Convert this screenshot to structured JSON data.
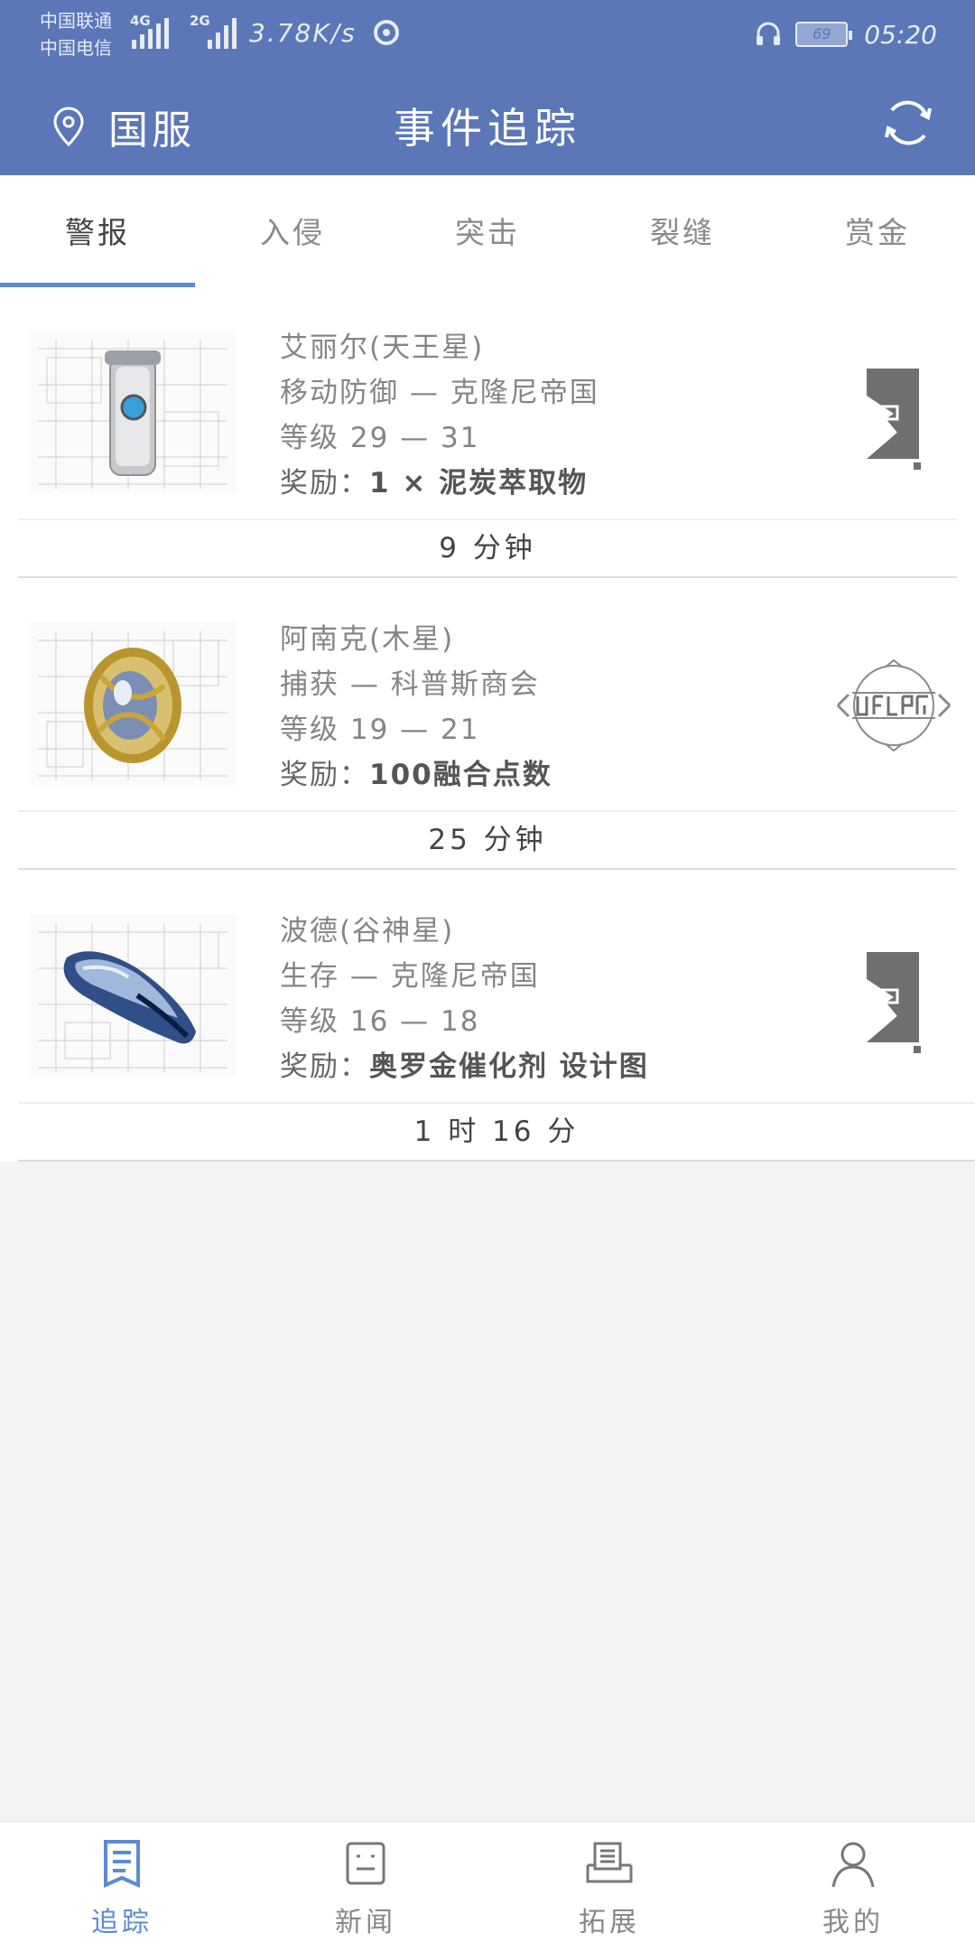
{
  "status_bar": {
    "carrier1": "中国联通",
    "carrier2": "中国电信",
    "net1": "4G",
    "net2": "2G",
    "speed": "3.78K/s",
    "battery": "69",
    "time": "05:20"
  },
  "header": {
    "region": "国服",
    "title": "事件追踪"
  },
  "tabs": [
    {
      "label": "警报",
      "active": true
    },
    {
      "label": "入侵",
      "active": false
    },
    {
      "label": "突击",
      "active": false
    },
    {
      "label": "裂缝",
      "active": false
    },
    {
      "label": "赏金",
      "active": false
    }
  ],
  "events": [
    {
      "node": "艾丽尔(天王星)",
      "mission": "移动防御 — 克隆尼帝国",
      "level": "等级 29 — 31",
      "reward_label": "奖励：",
      "reward": "1 × 泥炭萃取物",
      "time_left": "9 分钟",
      "faction_icon": "grineer-icon"
    },
    {
      "node": "阿南克(木星)",
      "mission": "捕获 — 科普斯商会",
      "level": "等级 19 — 21",
      "reward_label": "奖励：",
      "reward": "100融合点数",
      "time_left": "25 分钟",
      "faction_icon": "corpus-icon"
    },
    {
      "node": "波德(谷神星)",
      "mission": "生存 — 克隆尼帝国",
      "level": "等级 16 — 18",
      "reward_label": "奖励：",
      "reward": "奥罗金催化剂 设计图",
      "time_left": "1 时 16 分",
      "faction_icon": "grineer-icon"
    }
  ],
  "bottom_nav": [
    {
      "label": "追踪",
      "icon": "tracking-icon",
      "active": true
    },
    {
      "label": "新闻",
      "icon": "news-icon",
      "active": false
    },
    {
      "label": "拓展",
      "icon": "extension-icon",
      "active": false
    },
    {
      "label": "我的",
      "icon": "profile-icon",
      "active": false
    }
  ],
  "colors": {
    "header": "#5b77b8",
    "accent": "#5b8ad6",
    "background": "#f4f2f4"
  }
}
